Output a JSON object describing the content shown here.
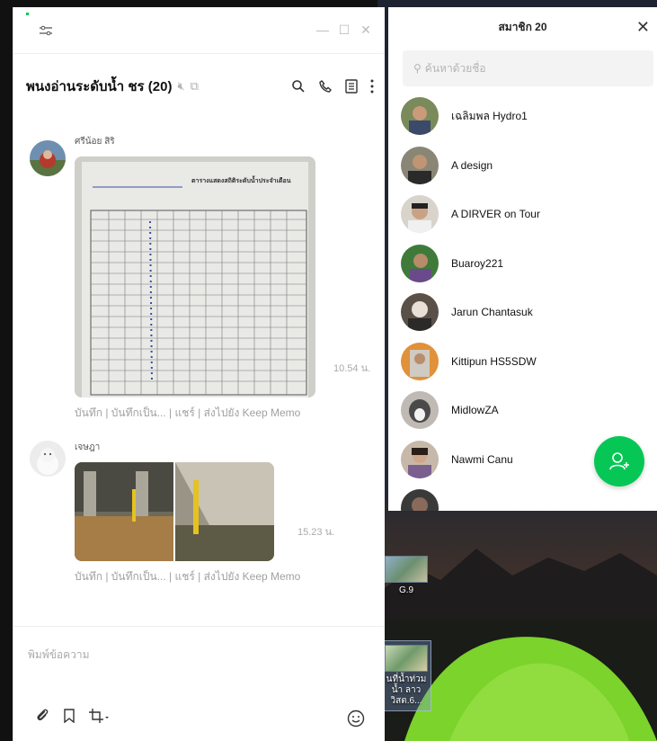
{
  "chat": {
    "title": "พนงอ่านระดับน้ำ ชร (20)",
    "messages": [
      {
        "sender": "ศรีน้อย สิริ",
        "time": "10.54 น.",
        "actions": "บันทึก | บันทึกเป็น... | แชร์ | ส่งไปยัง Keep Memo",
        "form_heading": "ตารางแสดงสถิติระดับน้ำประจำเดือน"
      },
      {
        "sender": "เจษฎา",
        "time": "15.23 น.",
        "actions": "บันทึก | บันทึกเป็น... | แชร์ | ส่งไปยัง Keep Memo"
      }
    ],
    "composer_placeholder": "พิมพ์ข้อความ"
  },
  "members_panel": {
    "title": "สมาชิก 20",
    "search_placeholder": "ค้นหาด้วยชื่อ",
    "members": [
      {
        "name": "เฉลิมพล Hydro1"
      },
      {
        "name": "A design"
      },
      {
        "name": "A DIRVER on Tour"
      },
      {
        "name": "Buaroy221"
      },
      {
        "name": "Jarun Chantasuk"
      },
      {
        "name": "Kittipun HS5SDW"
      },
      {
        "name": "MidlowZA"
      },
      {
        "name": "Nawmi Canu"
      }
    ]
  },
  "desktop": {
    "icons": [
      {
        "label": "G.9"
      },
      {
        "label": "นที่น้ำท่วมน้ำ ลาววิสต.6..."
      }
    ]
  },
  "colors": {
    "accent": "#06c755"
  }
}
